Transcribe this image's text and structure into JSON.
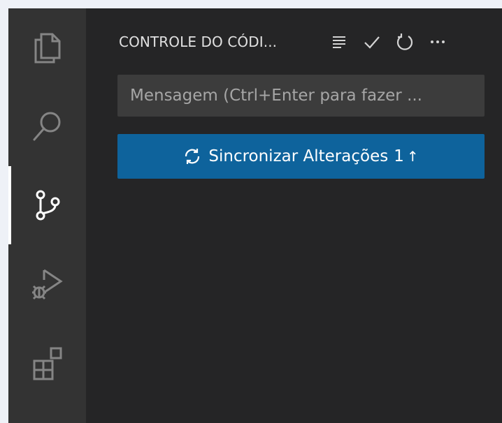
{
  "activity_bar": {
    "items": [
      {
        "icon": "files-icon",
        "active": false
      },
      {
        "icon": "search-icon",
        "active": false
      },
      {
        "icon": "source-control-icon",
        "active": true
      },
      {
        "icon": "run-debug-icon",
        "active": false
      },
      {
        "icon": "extensions-icon",
        "active": false
      }
    ]
  },
  "sidebar": {
    "title": "CONTROLE DO CÓDI...",
    "actions": [
      {
        "icon": "list-icon"
      },
      {
        "icon": "check-icon"
      },
      {
        "icon": "refresh-icon"
      },
      {
        "icon": "more-icon"
      }
    ]
  },
  "commit": {
    "message_value": "",
    "message_placeholder": "Mensagem (Ctrl+Enter para fazer ..."
  },
  "sync_button": {
    "label": "Sincronizar Alterações",
    "count": "1",
    "arrow": "↑"
  },
  "colors": {
    "accent": "#0e639c",
    "activity_bar_bg": "#333333",
    "sidebar_bg": "#252526",
    "input_bg": "#3c3c3c"
  }
}
